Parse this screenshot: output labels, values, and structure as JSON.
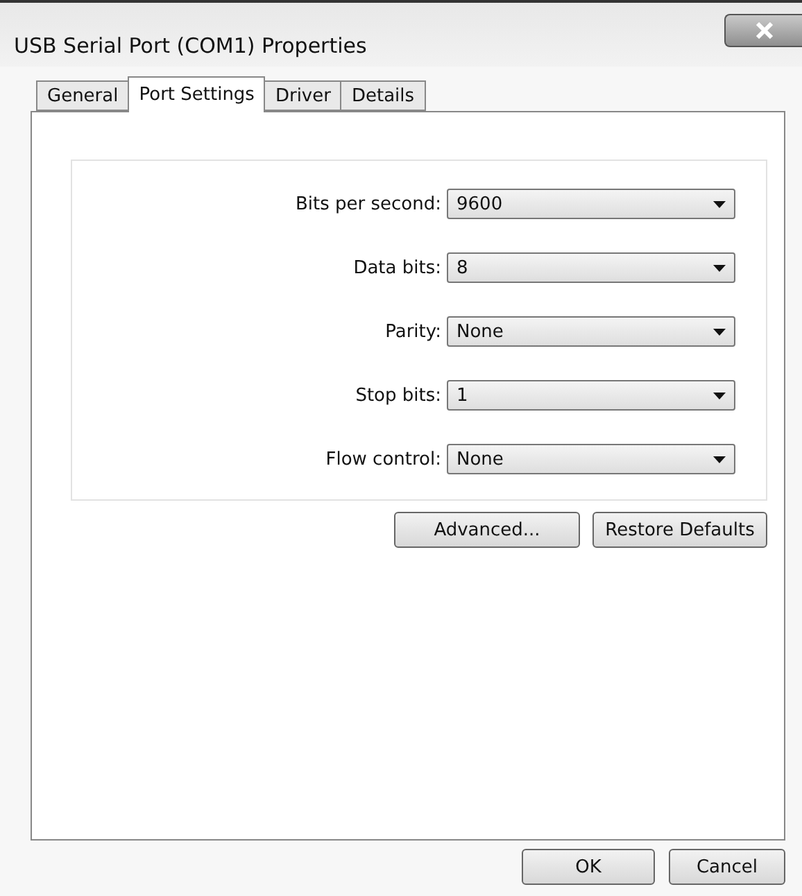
{
  "window": {
    "title": "USB Serial Port (COM1) Properties"
  },
  "tabs": [
    {
      "label": "General",
      "selected": false
    },
    {
      "label": "Port Settings",
      "selected": true
    },
    {
      "label": "Driver",
      "selected": false
    },
    {
      "label": "Details",
      "selected": false
    }
  ],
  "fields": [
    {
      "label": "Bits per second:",
      "value": "9600"
    },
    {
      "label": "Data bits:",
      "value": "8"
    },
    {
      "label": "Parity:",
      "value": "None"
    },
    {
      "label": "Stop bits:",
      "value": "1"
    },
    {
      "label": "Flow control:",
      "value": "None"
    }
  ],
  "panel_buttons": [
    "Advanced...",
    "Restore Defaults"
  ],
  "dialog_buttons": [
    "OK",
    "Cancel"
  ]
}
